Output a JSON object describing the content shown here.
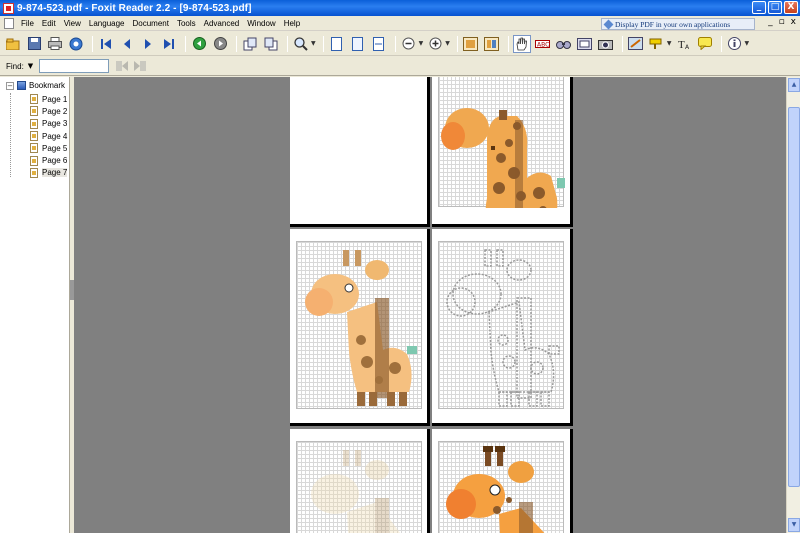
{
  "window": {
    "title": "9-874-523.pdf - Foxit Reader 2.2 - [9-874-523.pdf]",
    "controls": {
      "minimize": "_",
      "maximize": "□",
      "close": "X"
    }
  },
  "menu": {
    "items": [
      "File",
      "Edit",
      "View",
      "Language",
      "Document",
      "Tools",
      "Advanced",
      "Window",
      "Help"
    ],
    "promo": "Display PDF in your own applications",
    "mdi": {
      "minimize": "_",
      "restore": "▫",
      "close": "x"
    }
  },
  "toolbar": {
    "icons": [
      "open-icon",
      "save-icon",
      "print-icon",
      "email-icon",
      "first-page-icon",
      "prev-page-icon",
      "next-page-icon",
      "last-page-icon",
      "back-icon",
      "forward-icon",
      "rotate-left-icon",
      "rotate-right-icon",
      "zoom-icon",
      "actual-size-icon",
      "fit-page-icon",
      "fit-width-icon",
      "zoom-out-icon",
      "zoom-in-icon",
      "single-page-icon",
      "continuous-icon",
      "hand-icon",
      "select-text-icon",
      "find-icon",
      "snapshot-icon",
      "annotation-icon",
      "highlight-icon",
      "typewriter-icon",
      "note-icon",
      "info-icon"
    ]
  },
  "findbar": {
    "label": "Find:",
    "value": "",
    "placeholder": ""
  },
  "sidebar": {
    "root_label": "Bookmark",
    "items": [
      {
        "label": "Page 1"
      },
      {
        "label": "Page 2"
      },
      {
        "label": "Page 3"
      },
      {
        "label": "Page 4"
      },
      {
        "label": "Page 5"
      },
      {
        "label": "Page 6"
      },
      {
        "label": "Page 7",
        "selected": true
      }
    ]
  },
  "colors": {
    "titlebar": "#0a5fd8",
    "doc_background": "#808080",
    "giraffe_orange": "#f0a850",
    "giraffe_brown": "#8b5a2b",
    "giraffe_teal": "#7ec8b0"
  }
}
